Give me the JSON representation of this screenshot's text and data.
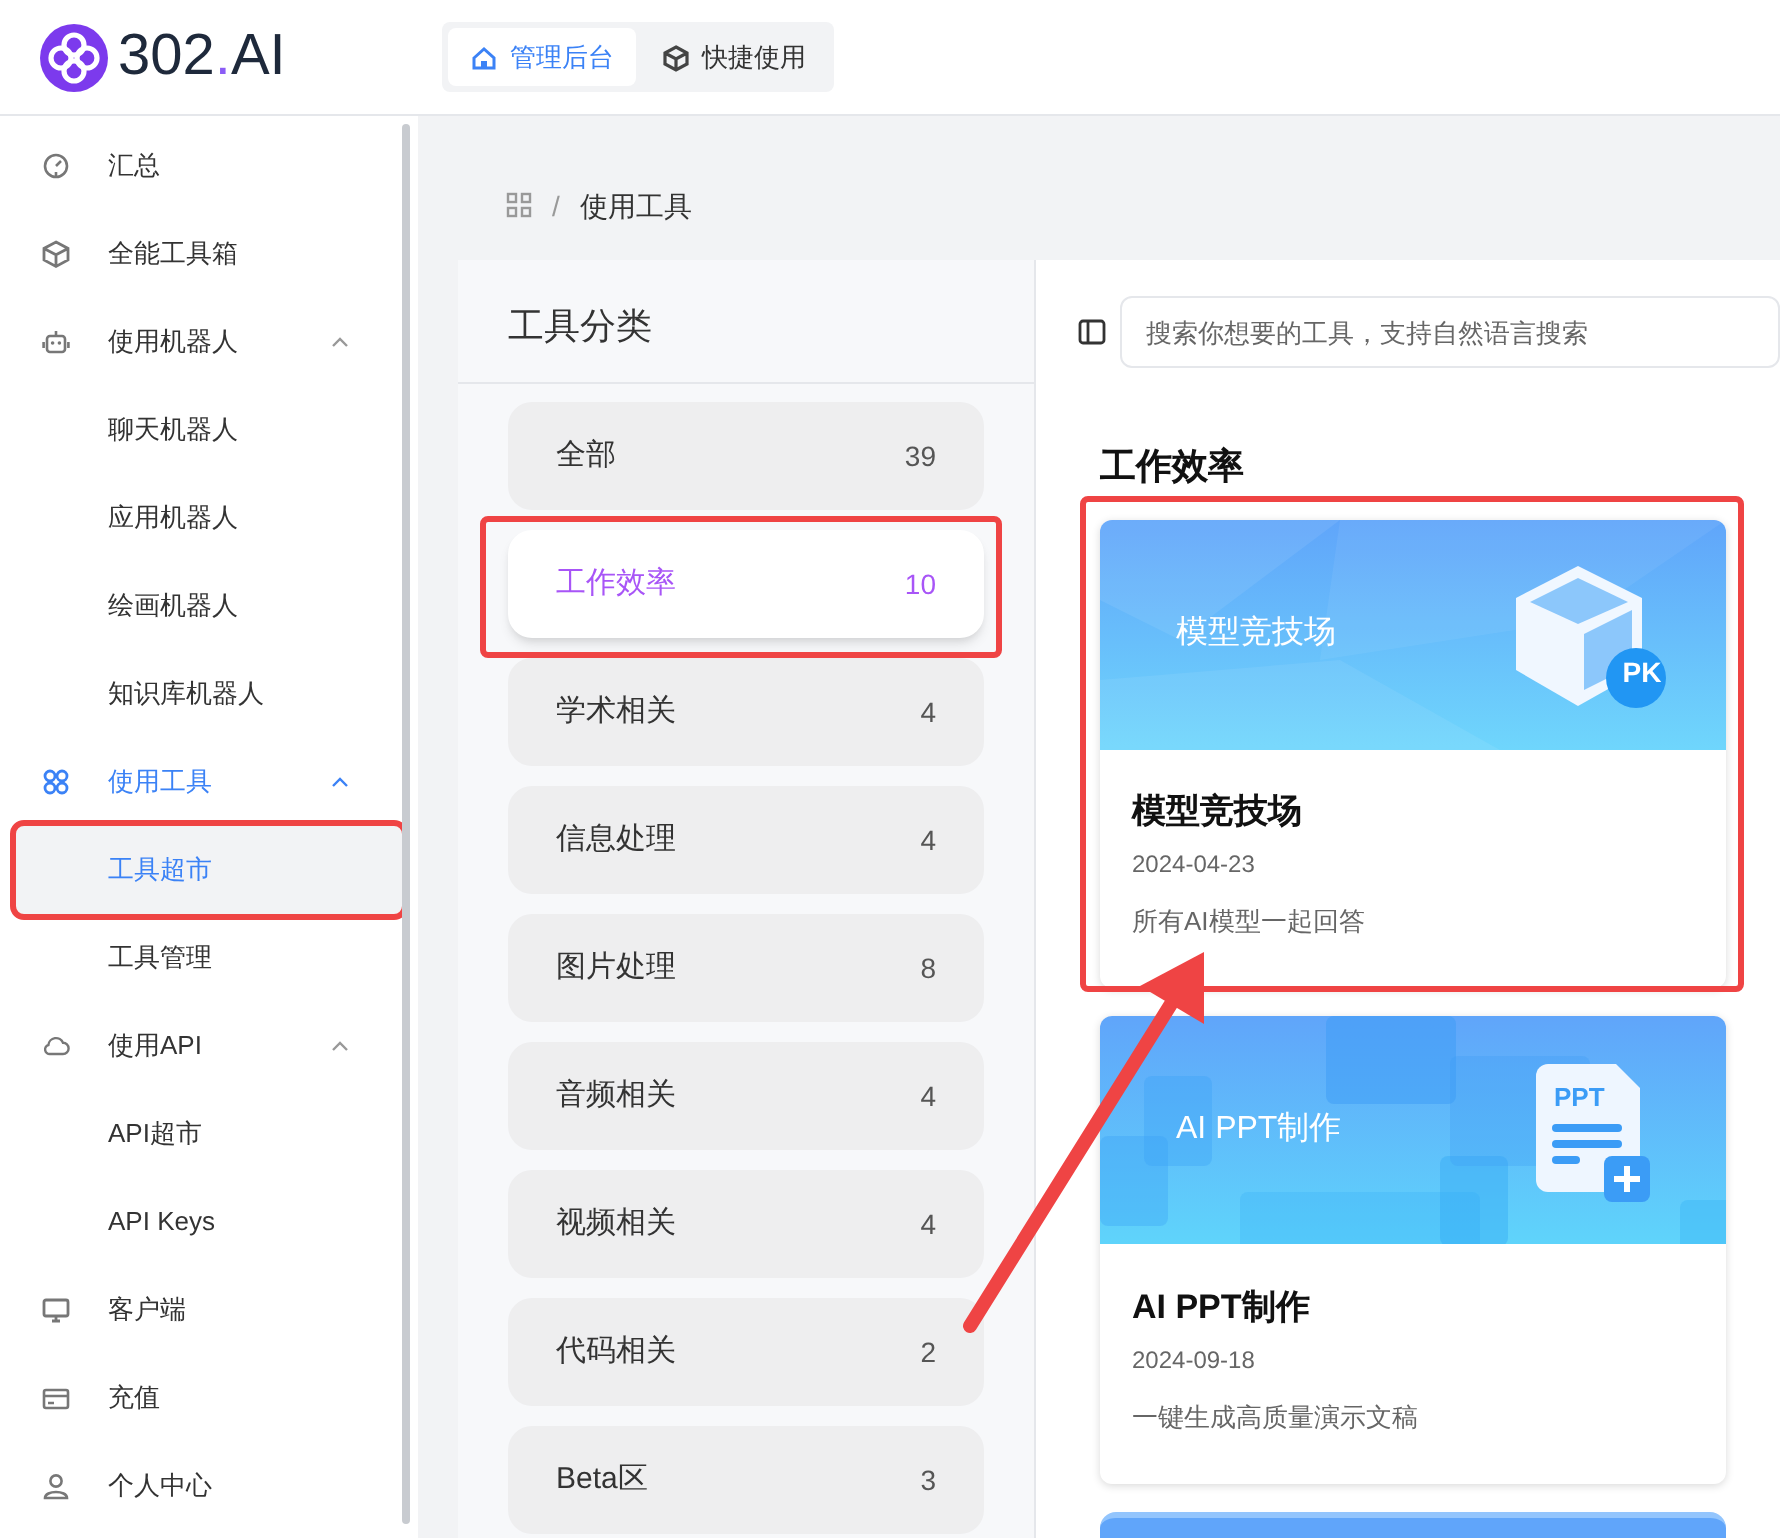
{
  "logo": {
    "parts": [
      {
        "text": "302",
        "color": "#1e293b"
      },
      {
        "text": ".",
        "color": "#8b5cf6"
      },
      {
        "text": "AI",
        "color": "#1e293b"
      }
    ]
  },
  "header_tabs": [
    {
      "label": "管理后台",
      "selected": true
    },
    {
      "label": "快捷使用",
      "selected": false
    }
  ],
  "sidebar": {
    "items": [
      {
        "label": "汇总",
        "selected": false
      },
      {
        "label": "全能工具箱",
        "selected": false
      },
      {
        "label": "使用机器人",
        "selected": false,
        "expanded": true,
        "children": [
          {
            "label": "聊天机器人",
            "selected": false
          },
          {
            "label": "应用机器人",
            "selected": false
          },
          {
            "label": "绘画机器人",
            "selected": false
          },
          {
            "label": "知识库机器人",
            "selected": false
          }
        ]
      },
      {
        "label": "使用工具",
        "selected": true,
        "expanded": true,
        "children": [
          {
            "label": "工具超市",
            "selected": true,
            "highlighted": true
          },
          {
            "label": "工具管理",
            "selected": false
          }
        ]
      },
      {
        "label": "使用API",
        "selected": false,
        "expanded": true,
        "children": [
          {
            "label": "API超市",
            "selected": false
          },
          {
            "label": "API Keys",
            "selected": false
          }
        ]
      },
      {
        "label": "客户端",
        "selected": false
      },
      {
        "label": "充值",
        "selected": false
      },
      {
        "label": "个人中心",
        "selected": false
      }
    ]
  },
  "breadcrumb": {
    "separator": "/",
    "current": "使用工具"
  },
  "categories": {
    "title": "工具分类",
    "items": [
      {
        "label": "全部",
        "count": "39",
        "selected": false
      },
      {
        "label": "工作效率",
        "count": "10",
        "selected": true,
        "highlighted": true
      },
      {
        "label": "学术相关",
        "count": "4",
        "selected": false
      },
      {
        "label": "信息处理",
        "count": "4",
        "selected": false
      },
      {
        "label": "图片处理",
        "count": "8",
        "selected": false
      },
      {
        "label": "音频相关",
        "count": "4",
        "selected": false
      },
      {
        "label": "视频相关",
        "count": "4",
        "selected": false
      },
      {
        "label": "代码相关",
        "count": "2",
        "selected": false
      },
      {
        "label": "Beta区",
        "count": "3",
        "selected": false
      }
    ]
  },
  "search": {
    "placeholder": "搜索你想要的工具，支持自然语言搜索"
  },
  "section_title": "工作效率",
  "tools": [
    {
      "kind": "pk",
      "banner_text": "模型竞技场",
      "badge": "PK",
      "title": "模型竞技场",
      "date": "2024-04-23",
      "description": "所有AI模型一起回答",
      "highlighted": true
    },
    {
      "kind": "ppt",
      "banner_text": "AI PPT制作",
      "badge": "PPT",
      "title": "AI PPT制作",
      "date": "2024-09-18",
      "description": "一键生成高质量演示文稿",
      "highlighted": false
    },
    {
      "kind": "partial"
    }
  ]
}
